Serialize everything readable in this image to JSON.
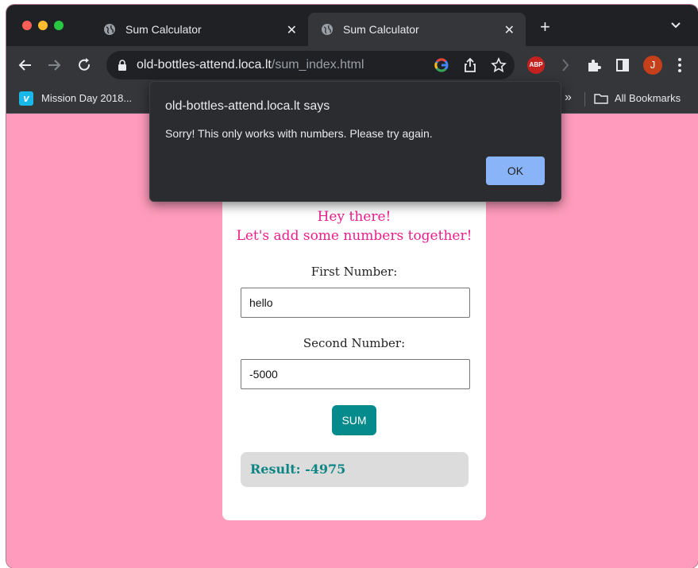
{
  "tabs": [
    {
      "title": "Sum Calculator",
      "active": false
    },
    {
      "title": "Sum Calculator",
      "active": true
    }
  ],
  "toolbar": {
    "url_host": "old-bottles-attend.loca.lt",
    "url_path": "/sum_index.html",
    "abp_label": "ABP",
    "avatar_initial": "J"
  },
  "bookmarks": {
    "item1": "Mission Day 2018...",
    "more": "»",
    "all": "All Bookmarks"
  },
  "page": {
    "greeting_line1": "Hey there!",
    "greeting_line2": "Let's add some numbers together!",
    "first_label": "First Number:",
    "first_value": "hello",
    "second_label": "Second Number:",
    "second_value": "-5000",
    "sum_label": "SUM",
    "result": "Result: -4975"
  },
  "dialog": {
    "title": "old-bottles-attend.loca.lt says",
    "message": "Sorry! This only works with numbers. Please try again.",
    "ok_label": "OK"
  },
  "colors": {
    "page_bg": "#ff9bbc",
    "greeting": "#e91e8c",
    "button": "#058b8b",
    "result_text": "#0e8585",
    "dialog_button": "#8ab4f8"
  }
}
